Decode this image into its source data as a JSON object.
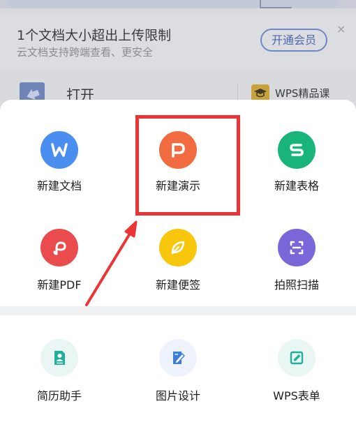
{
  "background": {
    "banner": {
      "title": "1个文档大小超出上传限制",
      "subtitle": "云文档支持跨端查看、更安全",
      "vip_button": "开通会员",
      "close_glyph": "×"
    },
    "row": {
      "open_label": "打开",
      "course_label": "WPS精品课"
    }
  },
  "sheet": {
    "row1": [
      {
        "label": "新建文档",
        "icon": "wps-writer-icon",
        "color": "#4a8ff0",
        "glyph": "W"
      },
      {
        "label": "新建演示",
        "icon": "wps-presentation-icon",
        "color": "#f16b40",
        "glyph": "P"
      },
      {
        "label": "新建表格",
        "icon": "wps-spreadsheet-icon",
        "color": "#18b47a",
        "glyph": "S"
      }
    ],
    "row2": [
      {
        "label": "新建PDF",
        "icon": "pdf-icon",
        "color": "#ea4b4c"
      },
      {
        "label": "新建便签",
        "icon": "note-leaf-icon",
        "color": "#f8c60b"
      },
      {
        "label": "拍照扫描",
        "icon": "scan-icon",
        "color": "#7b66d8"
      }
    ],
    "row3": [
      {
        "label": "简历助手",
        "icon": "resume-icon",
        "color": "#e9f6f4"
      },
      {
        "label": "图片设计",
        "icon": "image-design-icon",
        "color": "#eef3fb"
      },
      {
        "label": "WPS表单",
        "icon": "form-icon",
        "color": "#e9f6f4"
      }
    ]
  },
  "colors": {
    "highlight": "#ea3436"
  }
}
